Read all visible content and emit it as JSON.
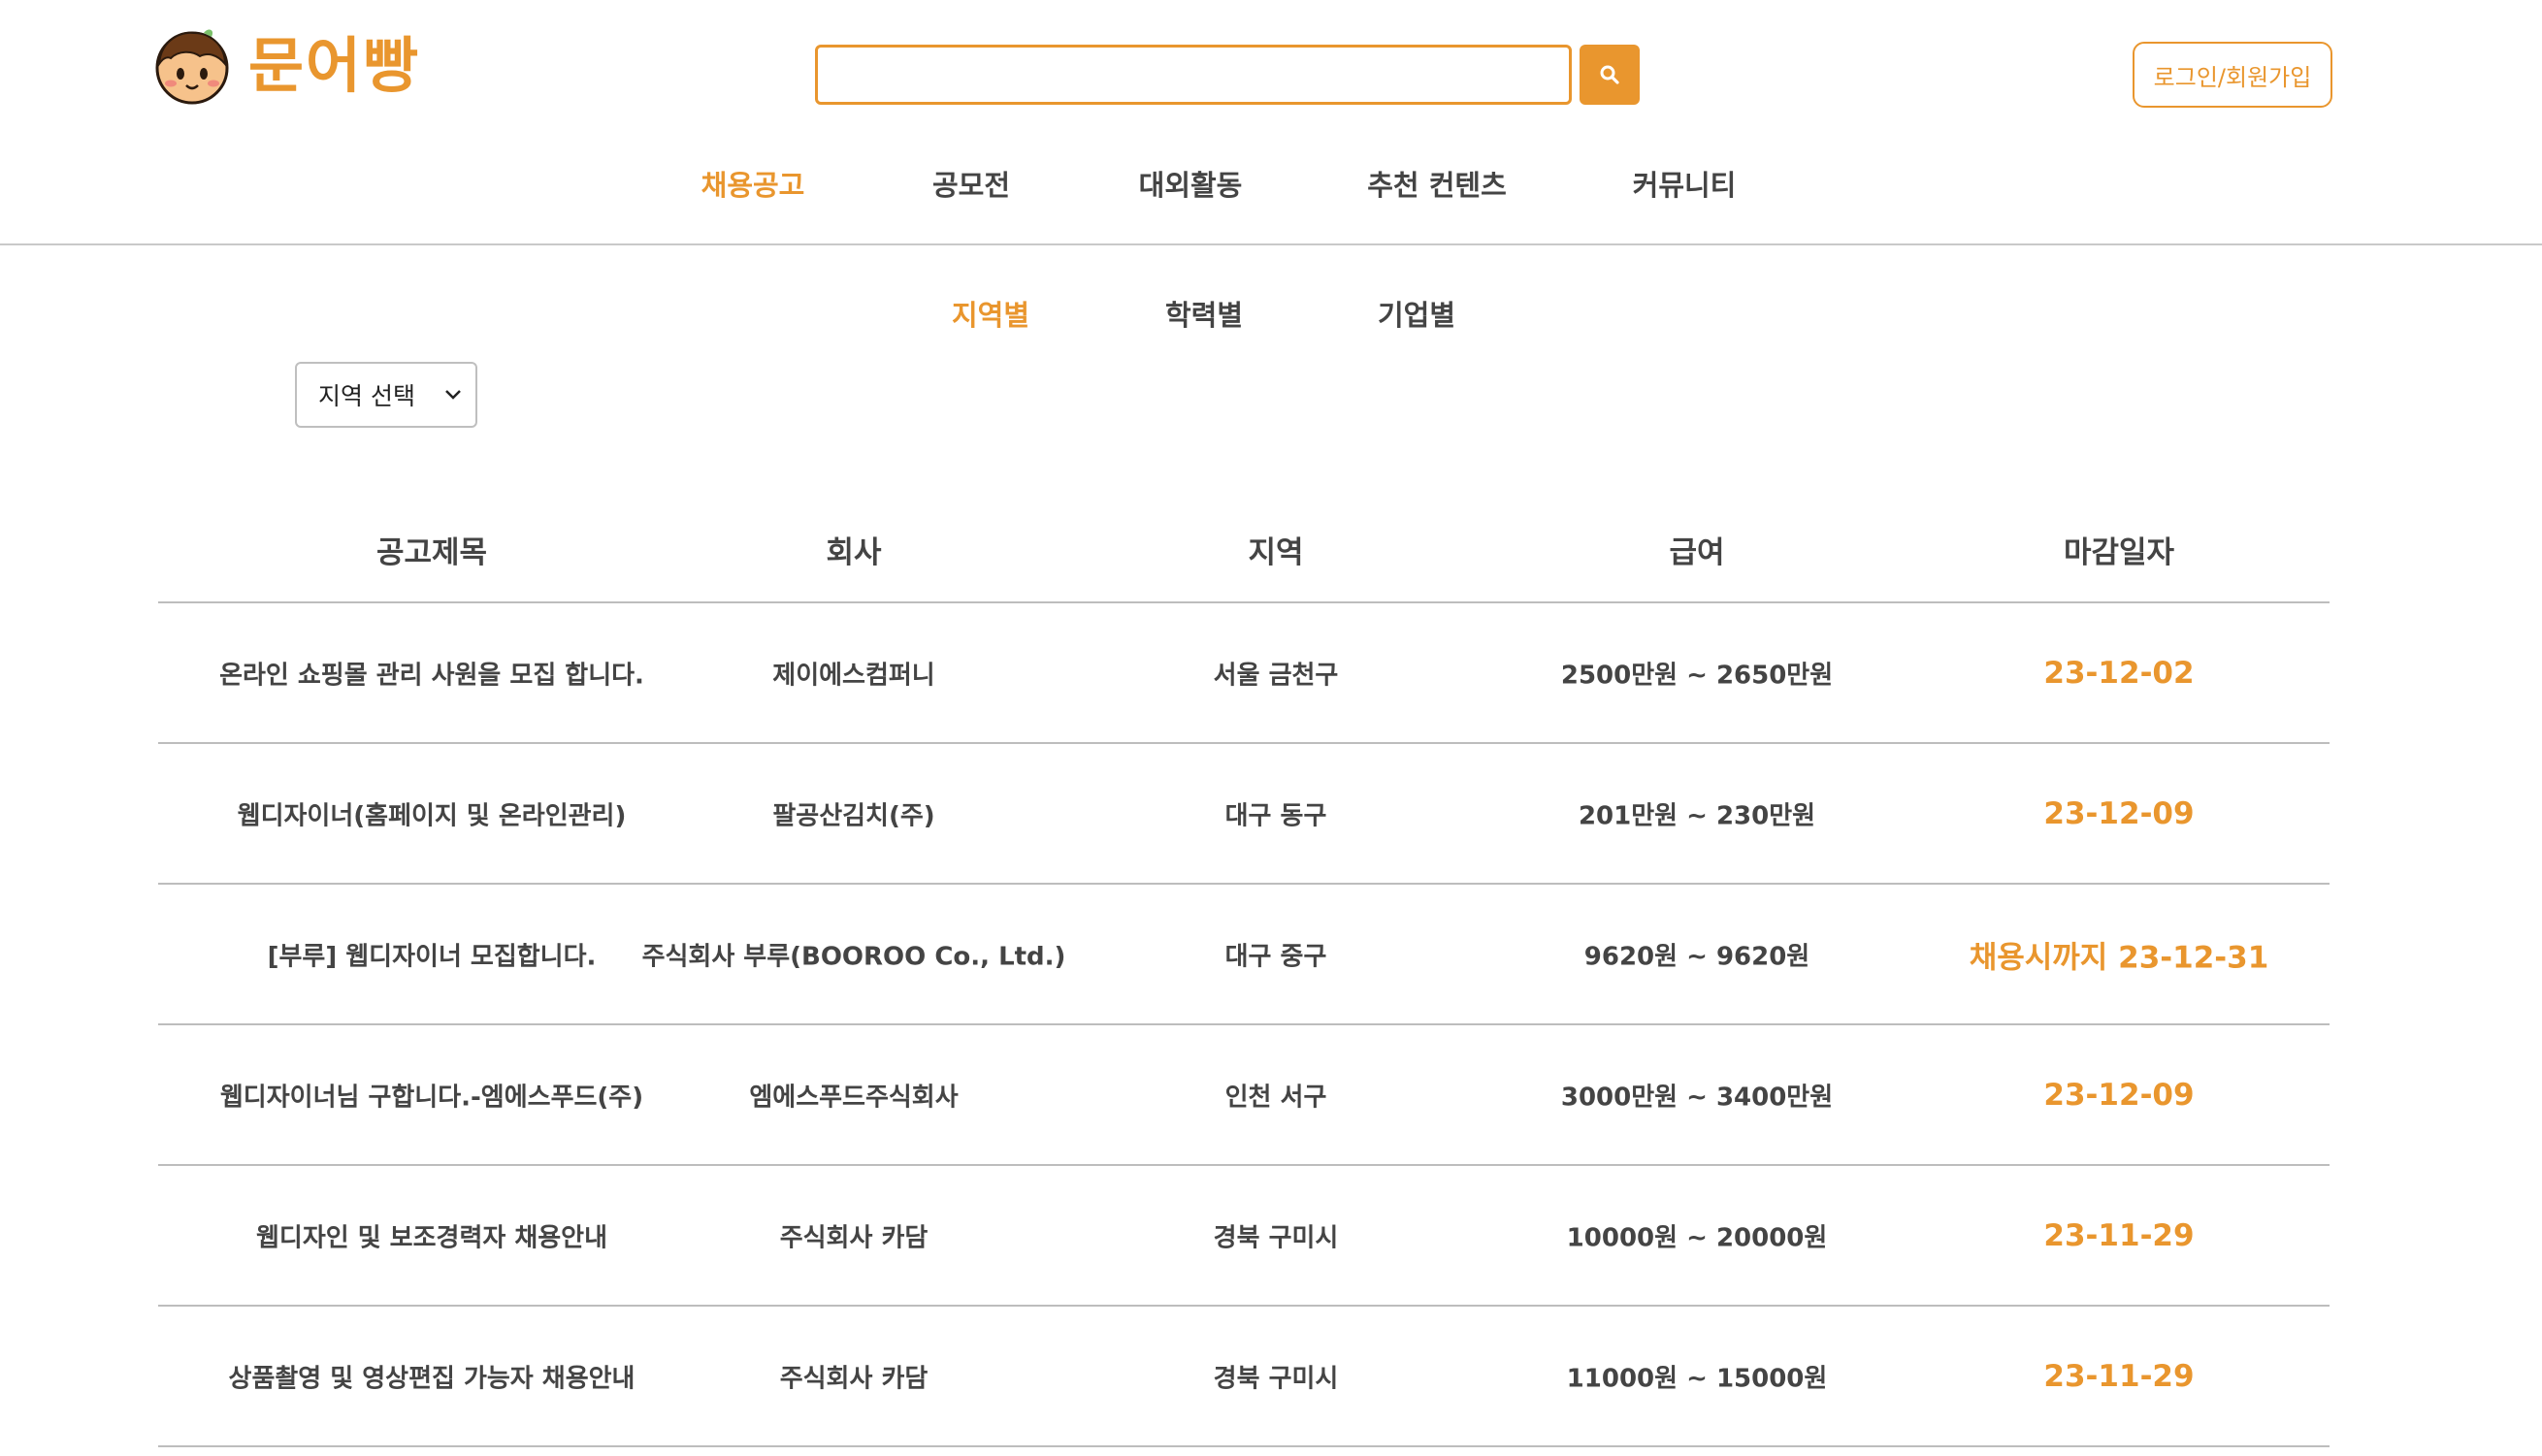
{
  "brand": {
    "name": "문어빵",
    "accent_color": "#e9962e",
    "mascot_icon": "takoyaki-mascot-icon"
  },
  "search": {
    "value": "",
    "placeholder": "",
    "button_icon": "search-icon"
  },
  "auth": {
    "login_label": "로그인/회원가입"
  },
  "main_nav": {
    "items": [
      {
        "label": "채용공고",
        "active": true
      },
      {
        "label": "공모전",
        "active": false
      },
      {
        "label": "대외활동",
        "active": false
      },
      {
        "label": "추천 컨텐츠",
        "active": false
      },
      {
        "label": "커뮤니티",
        "active": false
      }
    ]
  },
  "sub_nav": {
    "items": [
      {
        "label": "지역별",
        "active": true
      },
      {
        "label": "학력별",
        "active": false
      },
      {
        "label": "기업별",
        "active": false
      }
    ]
  },
  "filter": {
    "region_select": "지역 선택"
  },
  "table": {
    "headers": [
      "공고제목",
      "회사",
      "지역",
      "급여",
      "마감일자"
    ],
    "rows": [
      {
        "title": "온라인 쇼핑몰 관리 사원을 모집 합니다.",
        "company": "제이에스컴퍼니",
        "region": "서울 금천구",
        "salary": "2500만원 ~ 2650만원",
        "deadline": "23-12-02"
      },
      {
        "title": "웹디자이너(홈페이지 및 온라인관리)",
        "company": "팔공산김치(주)",
        "region": "대구 동구",
        "salary": "201만원 ~ 230만원",
        "deadline": "23-12-09"
      },
      {
        "title": "[부루] 웹디자이너 모집합니다.",
        "company": "주식회사 부루(BOOROO Co., Ltd.)",
        "region": "대구 중구",
        "salary": "9620원 ~ 9620원",
        "deadline": "채용시까지 23-12-31"
      },
      {
        "title": "웹디자이너님 구합니다.-엠에스푸드(주)",
        "company": "엠에스푸드주식회사",
        "region": "인천 서구",
        "salary": "3000만원 ~ 3400만원",
        "deadline": "23-12-09"
      },
      {
        "title": "웹디자인 및 보조경력자 채용안내",
        "company": "주식회사 카담",
        "region": "경북 구미시",
        "salary": "10000원 ~ 20000원",
        "deadline": "23-11-29"
      },
      {
        "title": "상품촬영 및 영상편집 가능자 채용안내",
        "company": "주식회사 카담",
        "region": "경북 구미시",
        "salary": "11000원 ~ 15000원",
        "deadline": "23-11-29"
      }
    ]
  }
}
